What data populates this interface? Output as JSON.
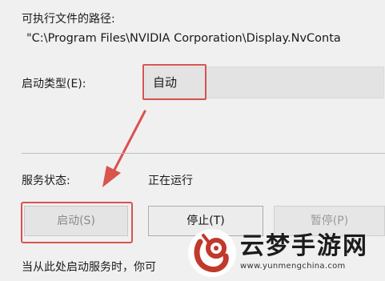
{
  "executable_path": {
    "label": "可执行文件的路径:",
    "value": "\"C:\\Program Files\\NVIDIA Corporation\\Display.NvConta"
  },
  "startup_type": {
    "label": "启动类型(E):",
    "value": "自动"
  },
  "service_status": {
    "label": "服务状态:",
    "value": "正在运行"
  },
  "buttons": {
    "start": "启动(S)",
    "stop": "停止(T)",
    "pause": "暂停(P)"
  },
  "note": "当从此处启动服务时，你可",
  "watermark": {
    "title": "云梦手游网",
    "url": "www.yunmengchina.com"
  },
  "colors": {
    "highlight": "#d9534f",
    "background": "#f0f0f0"
  }
}
